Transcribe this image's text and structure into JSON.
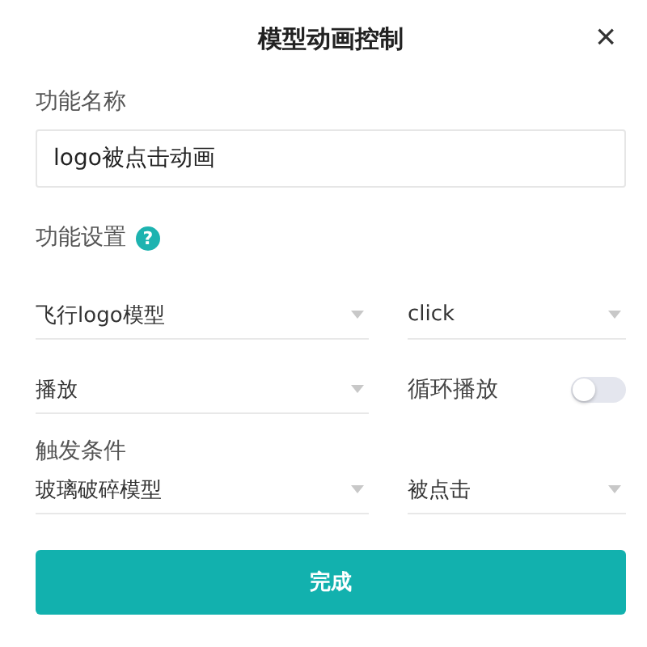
{
  "dialog": {
    "title": "模型动画控制",
    "close": "×"
  },
  "name_section": {
    "label": "功能名称",
    "value": "logo被点击动画"
  },
  "settings_section": {
    "label": "功能设置",
    "help": "?"
  },
  "row_1": [
    {
      "kind": "select",
      "value": "飞行logo模型"
    },
    {
      "kind": "select",
      "value": "click"
    }
  ],
  "row_2": [
    {
      "kind": "select",
      "value": "播放"
    },
    {
      "kind": "toggle",
      "label": "循环播放",
      "on": false
    }
  ],
  "trigger_section": {
    "label": "触发条件"
  },
  "row_3": [
    {
      "kind": "select",
      "value": "玻璃破碎模型"
    },
    {
      "kind": "select",
      "value": "被点击"
    }
  ],
  "button": "完成"
}
